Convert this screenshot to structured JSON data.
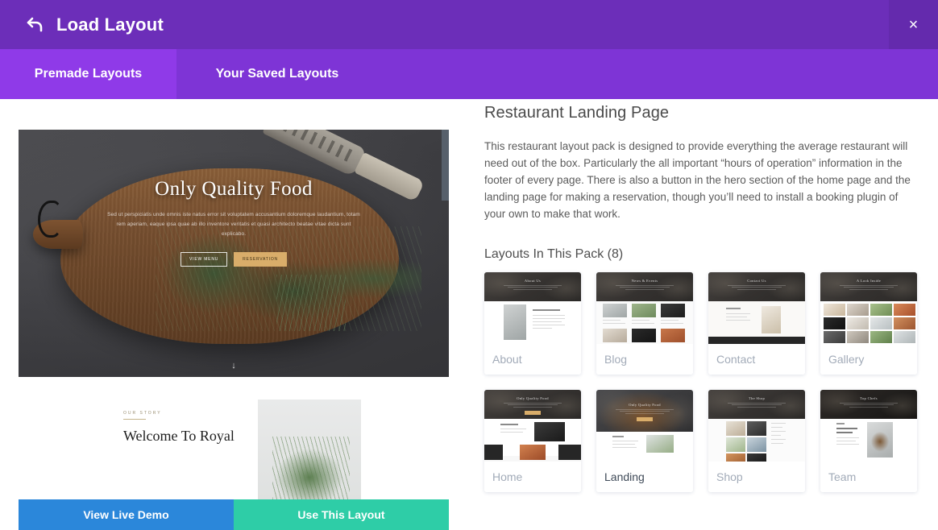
{
  "header": {
    "title": "Load Layout",
    "back_icon": "back-arrow-icon",
    "close_icon": "×"
  },
  "tabs": [
    {
      "label": "Premade Layouts",
      "active": true
    },
    {
      "label": "Your Saved Layouts",
      "active": false
    }
  ],
  "preview": {
    "hero": {
      "title": "Only Quality Food",
      "subtitle": "Sed ut perspiciatis unde omnis iste natus error sit voluptatem accusantium doloremque laudantium, totam rem aperiam, eaque ipsa quae ab illo inventore veritatis et quasi architecto beatae vitae dicta sunt explicabo.",
      "button_outline": "VIEW MENU",
      "button_gold": "RESERVATION",
      "scroll_arrow": "↓"
    },
    "section2": {
      "eyebrow": "OUR STORY",
      "title": "Welcome To Royal"
    },
    "actions": {
      "demo_label": "View Live Demo",
      "use_label": "Use This Layout",
      "demo_color": "#2b87da",
      "use_color": "#2ecda7"
    }
  },
  "details": {
    "pack_title": "Restaurant Landing Page",
    "description": "This restaurant layout pack is designed to provide everything the average restaurant will need out of the box. Particularly the all important “hours of operation” information in the footer of every page. There is also a button in the hero section of the home page and the landing page for making a reservation, though you’ll need to install a booking plugin of your own to make that work.",
    "layouts_heading": "Layouts In This Pack (8)",
    "layouts": [
      {
        "label": "About",
        "hero_text": "About Us",
        "selected": false,
        "kind": "about"
      },
      {
        "label": "Blog",
        "hero_text": "News & Events",
        "selected": false,
        "kind": "blog"
      },
      {
        "label": "Contact",
        "hero_text": "Contact Us",
        "selected": false,
        "kind": "contact"
      },
      {
        "label": "Gallery",
        "hero_text": "A Look Inside",
        "selected": false,
        "kind": "gallery"
      },
      {
        "label": "Home",
        "hero_text": "Only Quality Food",
        "selected": false,
        "kind": "home"
      },
      {
        "label": "Landing",
        "hero_text": "Only Quality Food",
        "selected": true,
        "kind": "landing"
      },
      {
        "label": "Shop",
        "hero_text": "The Shop",
        "selected": false,
        "kind": "shop"
      },
      {
        "label": "Team",
        "hero_text": "Top Chefs",
        "selected": false,
        "kind": "team"
      }
    ]
  },
  "colors": {
    "header_purple": "#6c2eb9",
    "tabbar_purple": "#7e34d6",
    "tab_active_purple": "#8f3ae8",
    "close_purple": "#642aad"
  }
}
